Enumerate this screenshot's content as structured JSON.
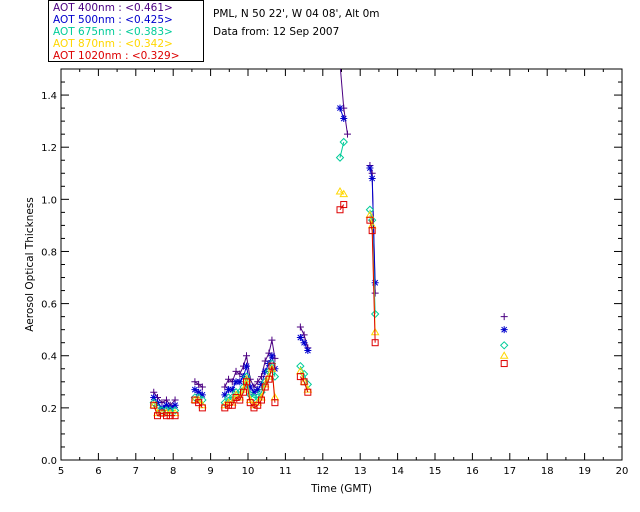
{
  "header": {
    "site_line": "PML, N 50 22', W 04 08', Alt 0m",
    "date_line": "Data from: 12 Sep 2007"
  },
  "legend": [
    {
      "text": "AOT  400nm : <0.461>",
      "color": "#4b0082"
    },
    {
      "text": "AOT  500nm : <0.425>",
      "color": "#0000cd"
    },
    {
      "text": "AOT  675nm : <0.383>",
      "color": "#00cc99"
    },
    {
      "text": "AOT  870nm : <0.342>",
      "color": "#ffd700"
    },
    {
      "text": "AOT 1020nm : <0.329>",
      "color": "#dd0000"
    }
  ],
  "chart_data": {
    "type": "line",
    "xlabel": "Time (GMT)",
    "ylabel": "Aerosol Optical Thickness",
    "xlim": [
      5,
      20
    ],
    "ylim": [
      0.0,
      1.5
    ],
    "xticks": [
      "5",
      "6",
      "7",
      "8",
      "9",
      "10",
      "11",
      "12",
      "13",
      "14",
      "15",
      "16",
      "17",
      "18",
      "19",
      "20"
    ],
    "yticks": [
      "0.0",
      "0.2",
      "0.4",
      "0.6",
      "0.8",
      "1.0",
      "1.2",
      "1.4"
    ],
    "series": [
      {
        "name": "AOT  400nm : <0.461>",
        "color": "#4b0082",
        "marker": "plus",
        "x": [
          7.48,
          7.58,
          7.7,
          7.82,
          7.92,
          8.05,
          8.58,
          8.68,
          8.78,
          9.38,
          9.48,
          9.58,
          9.68,
          9.78,
          9.88,
          9.96,
          10.06,
          10.16,
          10.26,
          10.36,
          10.46,
          10.56,
          10.64,
          10.72,
          11.4,
          11.5,
          11.6,
          12.46,
          12.56,
          12.66,
          13.26,
          13.32,
          13.4,
          16.85
        ],
        "y": [
          0.26,
          0.24,
          0.22,
          0.23,
          0.21,
          0.23,
          0.3,
          0.29,
          0.28,
          0.28,
          0.31,
          0.3,
          0.34,
          0.33,
          0.36,
          0.4,
          0.31,
          0.28,
          0.3,
          0.32,
          0.38,
          0.41,
          0.46,
          0.39,
          0.51,
          0.48,
          0.43,
          1.52,
          1.35,
          1.25,
          1.13,
          1.1,
          0.64,
          0.55
        ]
      },
      {
        "name": "AOT  500nm : <0.425>",
        "color": "#0000cd",
        "marker": "asterisk",
        "x": [
          7.48,
          7.58,
          7.7,
          7.82,
          7.92,
          8.05,
          8.58,
          8.68,
          8.78,
          9.38,
          9.48,
          9.58,
          9.68,
          9.78,
          9.88,
          9.96,
          10.06,
          10.16,
          10.26,
          10.36,
          10.46,
          10.56,
          10.64,
          10.72,
          11.4,
          11.5,
          11.6,
          12.46,
          12.56,
          13.26,
          13.32,
          13.4,
          16.85
        ],
        "y": [
          0.24,
          0.22,
          0.2,
          0.21,
          0.2,
          0.21,
          0.27,
          0.26,
          0.25,
          0.25,
          0.27,
          0.27,
          0.3,
          0.3,
          0.32,
          0.36,
          0.28,
          0.26,
          0.27,
          0.29,
          0.34,
          0.37,
          0.4,
          0.35,
          0.47,
          0.45,
          0.42,
          1.35,
          1.31,
          1.12,
          1.08,
          0.68,
          0.5
        ]
      },
      {
        "name": "AOT  675nm : <0.383>",
        "color": "#00cc99",
        "marker": "diamond",
        "x": [
          7.48,
          7.58,
          7.7,
          7.82,
          7.92,
          8.05,
          8.58,
          8.68,
          8.78,
          9.38,
          9.48,
          9.58,
          9.68,
          9.78,
          9.88,
          9.96,
          10.06,
          10.16,
          10.26,
          10.36,
          10.46,
          10.56,
          10.64,
          10.72,
          11.4,
          11.5,
          11.6,
          12.46,
          12.56,
          13.26,
          13.32,
          13.4,
          16.85
        ],
        "y": [
          0.22,
          0.2,
          0.19,
          0.19,
          0.19,
          0.19,
          0.24,
          0.24,
          0.23,
          0.22,
          0.24,
          0.24,
          0.26,
          0.26,
          0.28,
          0.32,
          0.25,
          0.24,
          0.24,
          0.26,
          0.3,
          0.34,
          0.37,
          0.32,
          0.36,
          0.33,
          0.29,
          1.16,
          1.22,
          0.96,
          0.92,
          0.56,
          0.44
        ]
      },
      {
        "name": "AOT  870nm : <0.342>",
        "color": "#ffd700",
        "marker": "triangle",
        "x": [
          7.48,
          7.58,
          7.7,
          7.82,
          7.92,
          8.05,
          8.58,
          8.68,
          8.78,
          9.38,
          9.48,
          9.58,
          9.68,
          9.78,
          9.88,
          9.96,
          10.06,
          10.16,
          10.26,
          10.36,
          10.46,
          10.56,
          10.64,
          10.72,
          11.4,
          11.5,
          11.6,
          12.46,
          12.56,
          13.26,
          13.32,
          13.4,
          16.85
        ],
        "y": [
          0.21,
          0.18,
          0.18,
          0.18,
          0.18,
          0.18,
          0.23,
          0.23,
          0.21,
          0.21,
          0.22,
          0.22,
          0.25,
          0.24,
          0.27,
          0.31,
          0.23,
          0.21,
          0.22,
          0.24,
          0.29,
          0.32,
          0.35,
          0.24,
          0.34,
          0.3,
          0.27,
          1.03,
          1.02,
          0.94,
          0.9,
          0.49,
          0.4
        ]
      },
      {
        "name": "AOT 1020nm : <0.329>",
        "color": "#dd0000",
        "marker": "square",
        "x": [
          7.48,
          7.58,
          7.7,
          7.82,
          7.92,
          8.05,
          8.58,
          8.68,
          8.78,
          9.38,
          9.48,
          9.58,
          9.68,
          9.78,
          9.88,
          9.96,
          10.06,
          10.16,
          10.26,
          10.36,
          10.46,
          10.56,
          10.64,
          10.72,
          11.4,
          11.5,
          11.6,
          12.46,
          12.56,
          13.26,
          13.32,
          13.4,
          16.85
        ],
        "y": [
          0.21,
          0.17,
          0.18,
          0.17,
          0.17,
          0.17,
          0.23,
          0.22,
          0.2,
          0.2,
          0.21,
          0.21,
          0.24,
          0.23,
          0.26,
          0.3,
          0.22,
          0.2,
          0.21,
          0.23,
          0.28,
          0.31,
          0.36,
          0.22,
          0.32,
          0.3,
          0.26,
          0.96,
          0.98,
          0.92,
          0.88,
          0.45,
          0.37
        ]
      }
    ]
  }
}
